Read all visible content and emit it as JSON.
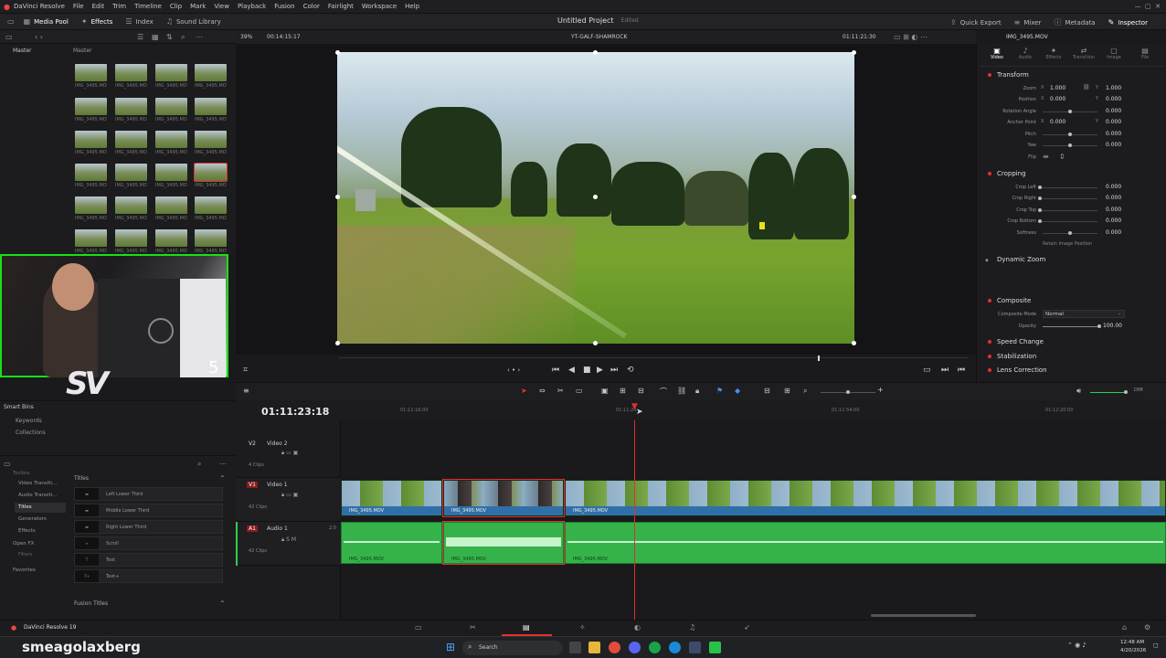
{
  "app": {
    "name": "DaVinci Resolve",
    "project_title": "Untitled Project",
    "project_status": "Edited",
    "version_label": "DaVinci Resolve 19"
  },
  "menu": [
    "DaVinci Resolve",
    "File",
    "Edit",
    "Trim",
    "Timeline",
    "Clip",
    "Mark",
    "View",
    "Playback",
    "Fusion",
    "Color",
    "Fairlight",
    "Workspace",
    "Help"
  ],
  "toolbar": {
    "left": [
      {
        "label": "Media Pool",
        "icon": "media-pool-icon"
      },
      {
        "label": "Effects",
        "icon": "effects-icon"
      },
      {
        "label": "Index",
        "icon": "index-icon"
      },
      {
        "label": "Sound Library",
        "icon": "sound-library-icon"
      }
    ],
    "right": [
      {
        "label": "Quick Export",
        "icon": "export-icon"
      },
      {
        "label": "Mixer",
        "icon": "mixer-icon"
      },
      {
        "label": "Metadata",
        "icon": "metadata-icon"
      },
      {
        "label": "Inspector",
        "icon": "inspector-icon"
      }
    ]
  },
  "media_pool": {
    "root": "Master",
    "bin_title": "Master",
    "thumbs_label": "IMG_3495.MOV"
  },
  "viewer": {
    "zoom": "39%",
    "source_timecode": "00:14:15:17",
    "timeline_name": "YT-GALF-SHAMROCK",
    "record_timecode": "01:11:21:30",
    "clip_name": "IMG_3495.MOV"
  },
  "stream": {
    "count_badge": "5",
    "logo_text": "SV",
    "username": "smeagolaxberg"
  },
  "smart_bins": {
    "title": "Smart Bins",
    "items": [
      "Keywords",
      "Collections"
    ]
  },
  "effects": {
    "tree": [
      "Toolbox",
      "Video Transiti...",
      "Audio Transiti...",
      "Titles",
      "Generators",
      "Effects",
      "Open FX",
      "Filters",
      "Favorites"
    ],
    "section": "Titles",
    "items": [
      "Left Lower Third",
      "Middle Lower Third",
      "Right Lower Third",
      "Scroll",
      "Text",
      "Text+"
    ],
    "fusion_section": "Fusion Titles"
  },
  "inspector": {
    "tabs": [
      "Video",
      "Audio",
      "Effects",
      "Transition",
      "Image",
      "File"
    ],
    "sections": {
      "transform": {
        "title": "Transform",
        "zoom_label": "Zoom",
        "zoom_x": "1.000",
        "zoom_y": "1.000",
        "position_label": "Position",
        "position_x": "0.000",
        "position_y": "0.000",
        "rotation_label": "Rotation Angle",
        "rotation": "0.000",
        "anchor_label": "Anchor Point",
        "anchor_x": "0.000",
        "anchor_y": "0.000",
        "pitch_label": "Pitch",
        "pitch": "0.000",
        "yaw_label": "Yaw",
        "yaw": "0.000",
        "flip_label": "Flip"
      },
      "cropping": {
        "title": "Cropping",
        "left_label": "Crop Left",
        "left": "0.000",
        "right_label": "Crop Right",
        "right": "0.000",
        "top_label": "Crop Top",
        "top": "0.000",
        "bottom_label": "Crop Bottom",
        "bottom": "0.000",
        "softness_label": "Softness",
        "softness": "0.000",
        "retain_label": "Retain Image Position"
      },
      "dynamic_zoom": {
        "title": "Dynamic Zoom"
      },
      "composite": {
        "title": "Composite",
        "mode_label": "Composite Mode",
        "mode": "Normal",
        "opacity_label": "Opacity",
        "opacity": "100.00"
      },
      "speed_change": {
        "title": "Speed Change"
      },
      "stabilization": {
        "title": "Stabilization"
      },
      "lens_correction": {
        "title": "Lens Correction"
      }
    }
  },
  "timeline": {
    "timecode": "01:11:23:18",
    "ruler": [
      "01:11:16:00",
      "01:11:20",
      "01:11:54:00",
      "01:12:20:00"
    ],
    "tracks": [
      {
        "id": "V2",
        "name": "Video 2",
        "clips": "4 Clips"
      },
      {
        "id": "V1",
        "name": "Video 1",
        "clips": "42 Clips"
      },
      {
        "id": "A1",
        "name": "Audio 1",
        "clips": "42 Clips",
        "channel": "2.0"
      }
    ],
    "clip_label": "IMG_3495.MOV",
    "audio_meter_label": "DIM"
  },
  "taskbar": {
    "search_placeholder": "Search",
    "time": "12:48 AM",
    "date": "4/20/2026"
  },
  "colors": {
    "accent_red": "#e03030",
    "video_clip_label": "#3070a8",
    "audio_clip": "#35b34a",
    "stream_frame": "#18e018"
  }
}
